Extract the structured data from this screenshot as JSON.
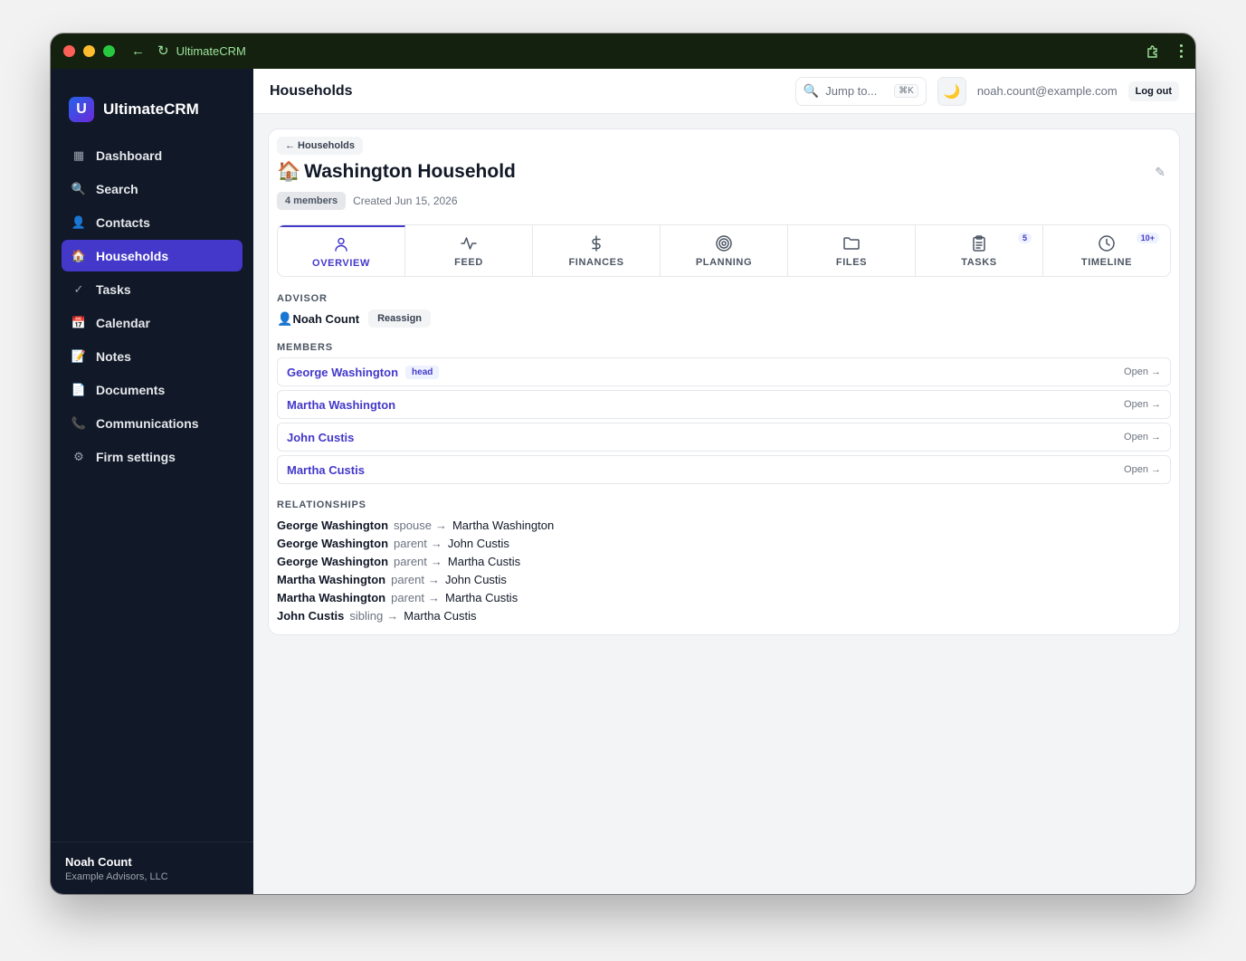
{
  "browser": {
    "title": "UltimateCRM",
    "back_icon": "arrow-left-icon",
    "reload_icon": "reload-icon",
    "extensions_icon": "puzzle-icon",
    "menu_icon": "kebab-icon"
  },
  "sidebar": {
    "brand_letter": "U",
    "brand_name": "UltimateCRM",
    "items": [
      {
        "label": "Dashboard",
        "icon": "▦",
        "active": false
      },
      {
        "label": "Search",
        "icon": "🔍",
        "active": false
      },
      {
        "label": "Contacts",
        "icon": "👤",
        "active": false
      },
      {
        "label": "Households",
        "icon": "🏠",
        "active": true
      },
      {
        "label": "Tasks",
        "icon": "✓",
        "active": false
      },
      {
        "label": "Calendar",
        "icon": "📅",
        "active": false
      },
      {
        "label": "Notes",
        "icon": "📝",
        "active": false
      },
      {
        "label": "Documents",
        "icon": "📄",
        "active": false
      },
      {
        "label": "Communications",
        "icon": "📞",
        "active": false
      },
      {
        "label": "Firm settings",
        "icon": "⚙",
        "active": false
      }
    ],
    "footer": {
      "name": "Noah Count",
      "org": "Example Advisors, LLC"
    }
  },
  "topbar": {
    "title": "Households",
    "jump_placeholder": "Jump to...",
    "jump_shortcut": "⌘K",
    "theme_icon": "🌙",
    "user_email": "noah.count@example.com",
    "logout_label": "Log out"
  },
  "household": {
    "back_label": "← Households",
    "emoji": "🏠",
    "name": "Washington Household",
    "edit_icon": "✎",
    "members_badge": "4 members",
    "created": "Created Jun 15, 2026"
  },
  "tabs": [
    {
      "label": "OVERVIEW",
      "icon": "user-icon",
      "badge": null,
      "active": true
    },
    {
      "label": "FEED",
      "icon": "activity-icon",
      "badge": null,
      "active": false
    },
    {
      "label": "FINANCES",
      "icon": "dollar-icon",
      "badge": null,
      "active": false
    },
    {
      "label": "PLANNING",
      "icon": "target-icon",
      "badge": null,
      "active": false
    },
    {
      "label": "FILES",
      "icon": "folder-icon",
      "badge": null,
      "active": false
    },
    {
      "label": "TASKS",
      "icon": "clipboard-icon",
      "badge": "5",
      "active": false
    },
    {
      "label": "TIMELINE",
      "icon": "clock-icon",
      "badge": "10+",
      "active": false
    }
  ],
  "advisor": {
    "section_label": "ADVISOR",
    "icon": "👤",
    "name": "Noah Count",
    "reassign_label": "Reassign"
  },
  "members": {
    "section_label": "MEMBERS",
    "open_label": "Open →",
    "items": [
      {
        "name": "George Washington",
        "badge": "head"
      },
      {
        "name": "Martha Washington",
        "badge": null
      },
      {
        "name": "John Custis",
        "badge": null
      },
      {
        "name": "Martha Custis",
        "badge": null
      }
    ]
  },
  "relationships": {
    "section_label": "RELATIONSHIPS",
    "arrow": "→",
    "items": [
      {
        "from": "George Washington",
        "kind": "spouse",
        "to": "Martha Washington"
      },
      {
        "from": "George Washington",
        "kind": "parent",
        "to": "John Custis"
      },
      {
        "from": "George Washington",
        "kind": "parent",
        "to": "Martha Custis"
      },
      {
        "from": "Martha Washington",
        "kind": "parent",
        "to": "John Custis"
      },
      {
        "from": "Martha Washington",
        "kind": "parent",
        "to": "Martha Custis"
      },
      {
        "from": "John Custis",
        "kind": "sibling",
        "to": "Martha Custis"
      }
    ]
  }
}
